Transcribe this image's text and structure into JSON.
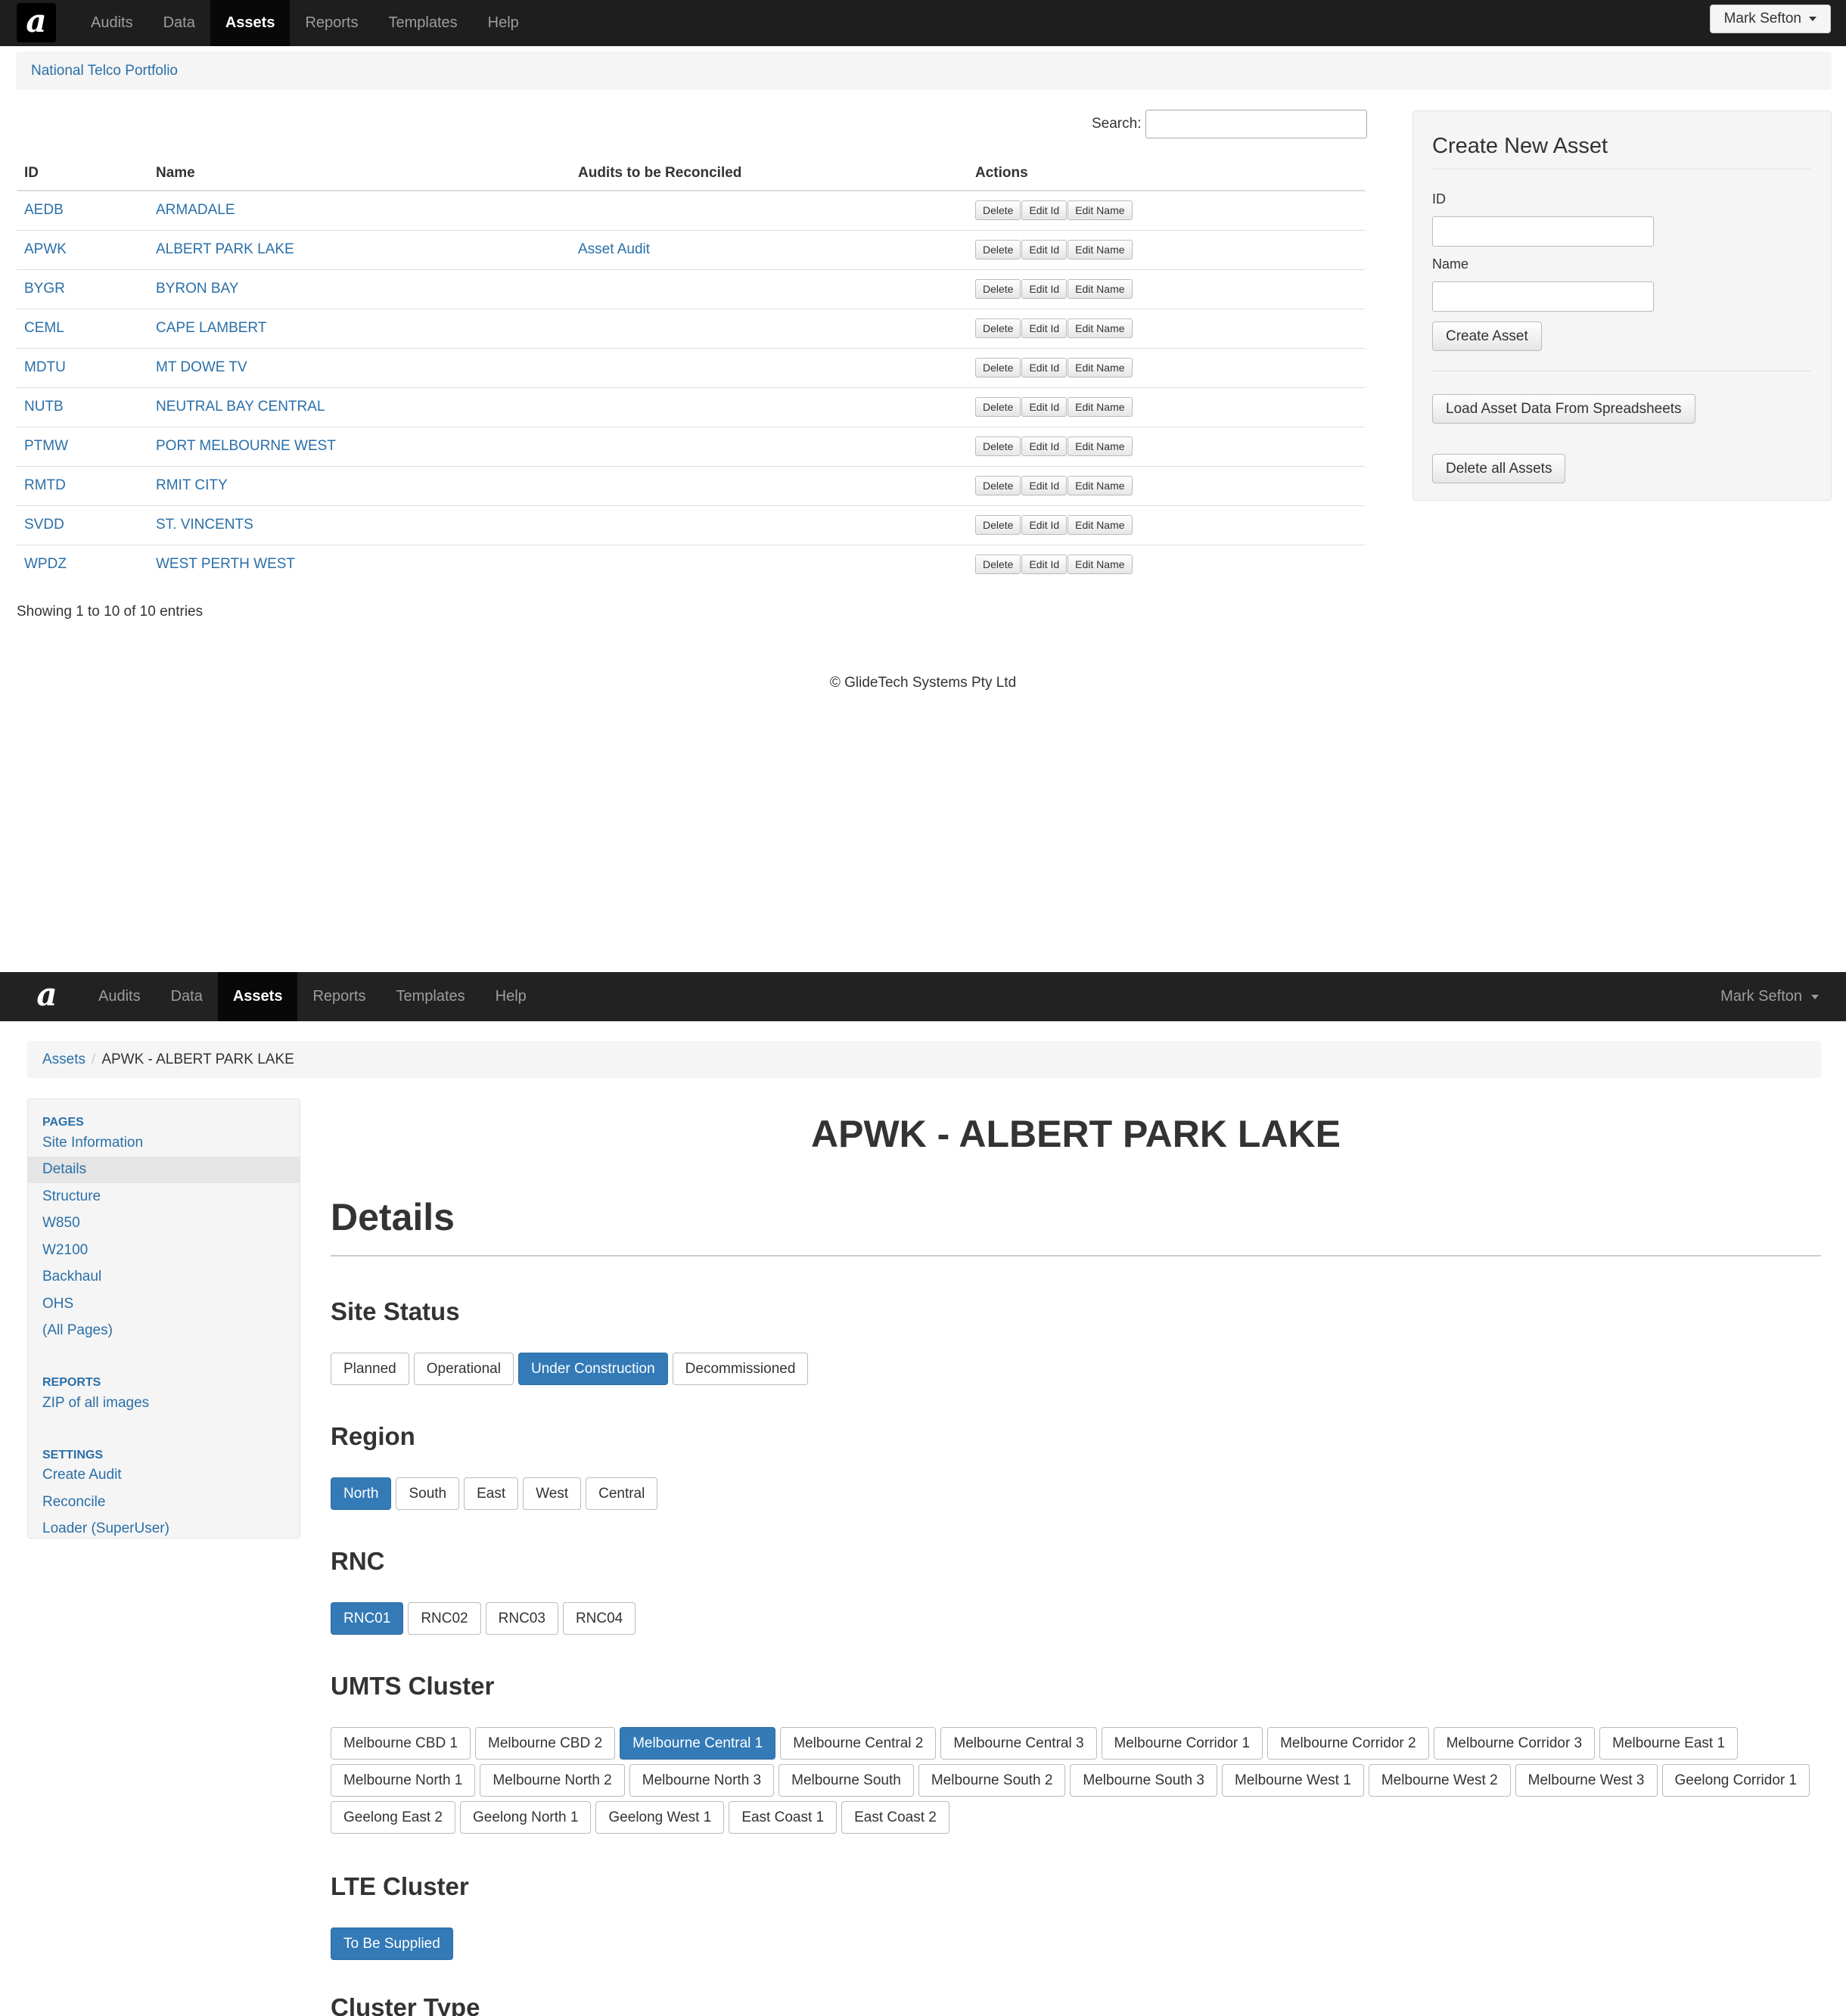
{
  "nav": {
    "items": [
      "Audits",
      "Data",
      "Assets",
      "Reports",
      "Templates",
      "Help"
    ],
    "active": "Assets",
    "user": "Mark Sefton"
  },
  "top": {
    "breadcrumb": "National Telco Portfolio",
    "search_label": "Search:",
    "search_value": "",
    "columns": [
      "ID",
      "Name",
      "Audits to be Reconciled",
      "Actions"
    ],
    "actions": [
      "Delete",
      "Edit Id",
      "Edit Name"
    ],
    "rows": [
      {
        "id": "AEDB",
        "name": "ARMADALE",
        "audit": ""
      },
      {
        "id": "APWK",
        "name": "ALBERT PARK LAKE",
        "audit": "Asset Audit"
      },
      {
        "id": "BYGR",
        "name": "BYRON BAY",
        "audit": ""
      },
      {
        "id": "CEML",
        "name": "CAPE LAMBERT",
        "audit": ""
      },
      {
        "id": "MDTU",
        "name": "MT DOWE TV",
        "audit": ""
      },
      {
        "id": "NUTB",
        "name": "NEUTRAL BAY CENTRAL",
        "audit": ""
      },
      {
        "id": "PTMW",
        "name": "PORT MELBOURNE WEST",
        "audit": ""
      },
      {
        "id": "RMTD",
        "name": "RMIT CITY",
        "audit": ""
      },
      {
        "id": "SVDD",
        "name": "ST. VINCENTS",
        "audit": ""
      },
      {
        "id": "WPDZ",
        "name": "WEST PERTH WEST",
        "audit": ""
      }
    ],
    "showing": "Showing 1 to 10 of 10 entries",
    "footer": "© GlideTech Systems Pty Ltd",
    "panel": {
      "title": "Create New Asset",
      "id_label": "ID",
      "name_label": "Name",
      "create_button": "Create Asset",
      "load_button": "Load Asset Data From Spreadsheets",
      "delete_all_button": "Delete all Assets"
    }
  },
  "bottom": {
    "breadcrumb_root": "Assets",
    "breadcrumb_current": "APWK - ALBERT PARK LAKE",
    "sidebar": {
      "pages_header": "PAGES",
      "pages": [
        "Site Information",
        "Details",
        "Structure",
        "W850",
        "W2100",
        "Backhaul",
        "OHS",
        "(All Pages)"
      ],
      "active_page": "Details",
      "reports_header": "REPORTS",
      "reports": [
        "ZIP of all images"
      ],
      "settings_header": "SETTINGS",
      "settings": [
        "Create Audit",
        "Reconcile",
        "Loader (SuperUser)"
      ]
    },
    "asset_title": "APWK - ALBERT PARK LAKE",
    "page_heading": "Details",
    "sections": [
      {
        "title": "Site Status",
        "options": [
          "Planned",
          "Operational",
          "Under Construction",
          "Decommissioned"
        ],
        "selected": "Under Construction"
      },
      {
        "title": "Region",
        "options": [
          "North",
          "South",
          "East",
          "West",
          "Central"
        ],
        "selected": "North"
      },
      {
        "title": "RNC",
        "options": [
          "RNC01",
          "RNC02",
          "RNC03",
          "RNC04"
        ],
        "selected": "RNC01"
      },
      {
        "title": "UMTS Cluster",
        "options": [
          "Melbourne CBD 1",
          "Melbourne CBD 2",
          "Melbourne Central 1",
          "Melbourne Central 2",
          "Melbourne Central 3",
          "Melbourne Corridor 1",
          "Melbourne Corridor 2",
          "Melbourne Corridor 3",
          "Melbourne East 1",
          "Melbourne North 1",
          "Melbourne North 2",
          "Melbourne North 3",
          "Melbourne South",
          "Melbourne South 2",
          "Melbourne South 3",
          "Melbourne West 1",
          "Melbourne West 2",
          "Melbourne West 3",
          "Geelong Corridor 1",
          "Geelong East 2",
          "Geelong North 1",
          "Geelong West 1",
          "East Coast 1",
          "East Coast 2"
        ],
        "selected": "Melbourne Central 1"
      },
      {
        "title": "LTE Cluster",
        "options": [
          "To Be Supplied"
        ],
        "selected": "To Be Supplied"
      },
      {
        "title": "Cluster Type",
        "options": [],
        "selected": ""
      }
    ]
  },
  "colors": {
    "navbar": "#1e1e1e",
    "link": "#2a6fa8",
    "selected": "#337ab7"
  }
}
